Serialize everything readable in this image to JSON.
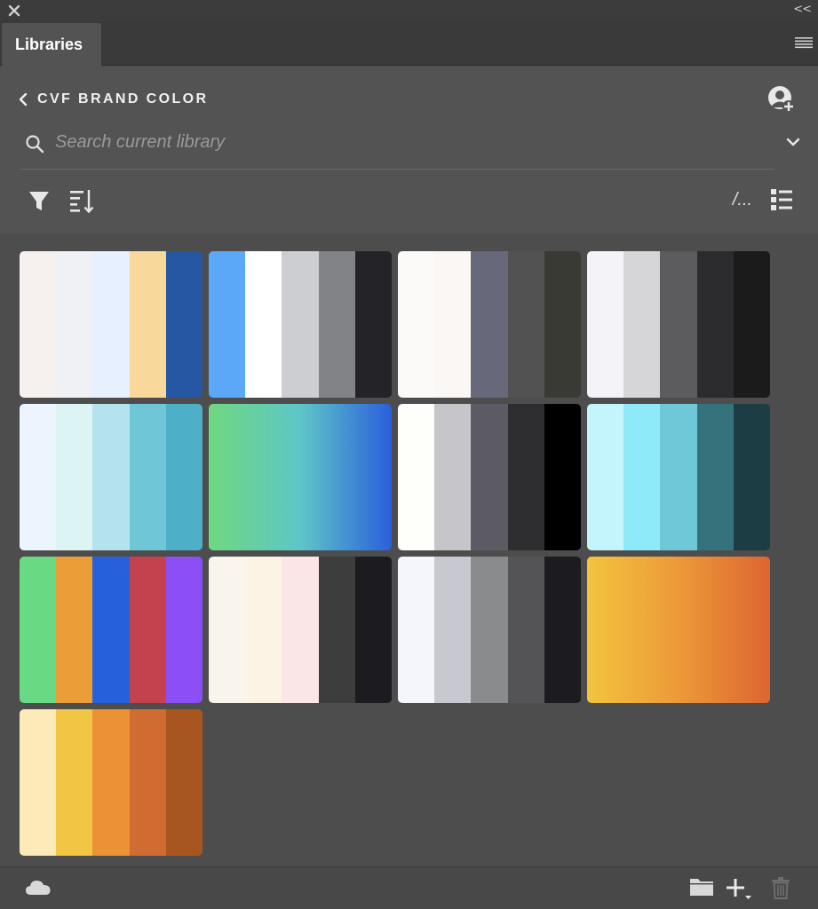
{
  "window": {
    "close_icon": "close-icon",
    "collapse_label": "<<"
  },
  "tabs": [
    {
      "label": "Libraries"
    }
  ],
  "library": {
    "name": "CVF BRAND COLOR"
  },
  "search": {
    "placeholder": "Search current library"
  },
  "toolbar": {
    "view_label": "/..."
  },
  "themes": [
    {
      "type": "swatches",
      "colors": [
        "#f6f1ee",
        "#f0f1f5",
        "#e6f0fe",
        "#f8d99b",
        "#2657a3"
      ]
    },
    {
      "type": "swatches",
      "colors": [
        "#5ba8f8",
        "#fefffe",
        "#cdced2",
        "#828386",
        "#232328"
      ]
    },
    {
      "type": "swatches",
      "colors": [
        "#fbfaf8",
        "#fbf7f4",
        "#676879",
        "#525252",
        "#3a3a34"
      ]
    },
    {
      "type": "swatches",
      "colors": [
        "#f4f4f8",
        "#d6d6d8",
        "#5c5c5f",
        "#2c2c2f",
        "#1b1b1b"
      ]
    },
    {
      "type": "swatches",
      "colors": [
        "#ecf5fd",
        "#dcf4f4",
        "#b5e3ed",
        "#6ec6d6",
        "#4eafc9"
      ]
    },
    {
      "type": "gradient",
      "colors": [
        "#6fd87e",
        "#5ec6c8",
        "#2b5fdb"
      ]
    },
    {
      "type": "swatches",
      "colors": [
        "#fefffa",
        "#c6c6ca",
        "#5c5b63",
        "#2e2e31",
        "#000000"
      ]
    },
    {
      "type": "swatches",
      "colors": [
        "#c4f5fd",
        "#8ee9f9",
        "#6ec8d8",
        "#35727c",
        "#1b3d43"
      ]
    },
    {
      "type": "swatches",
      "colors": [
        "#6ad983",
        "#eb9e38",
        "#2660da",
        "#c4414e",
        "#8b4ff5"
      ]
    },
    {
      "type": "swatches",
      "colors": [
        "#f9f5ed",
        "#fcf3e5",
        "#fbe6e6",
        "#3d3d3d",
        "#1c1b20"
      ]
    },
    {
      "type": "swatches",
      "colors": [
        "#f5f6fb",
        "#c8c8d1",
        "#8a8b8c",
        "#545456",
        "#1c1c20"
      ]
    },
    {
      "type": "gradient",
      "colors": [
        "#f3c43e",
        "#ec9a38",
        "#dd6531"
      ]
    },
    {
      "type": "swatches",
      "colors": [
        "#fcebb8",
        "#f2c544",
        "#eb9136",
        "#d06c32",
        "#a8561f"
      ]
    }
  ],
  "bottom": {
    "cloud_icon": "cloud-icon",
    "folder_icon": "folder-icon",
    "add_icon": "plus-icon",
    "trash_icon": "trash-icon"
  }
}
